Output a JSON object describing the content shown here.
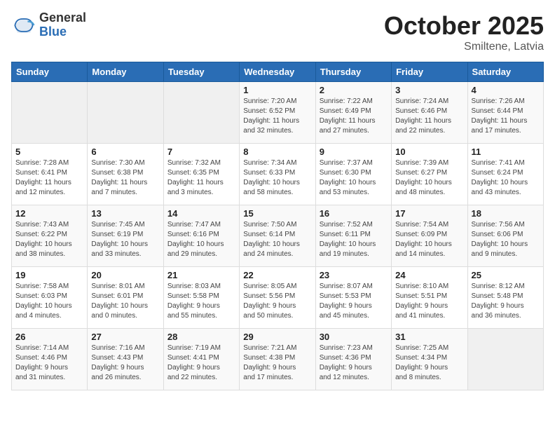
{
  "logo": {
    "general": "General",
    "blue": "Blue"
  },
  "title": "October 2025",
  "subtitle": "Smiltene, Latvia",
  "days_of_week": [
    "Sunday",
    "Monday",
    "Tuesday",
    "Wednesday",
    "Thursday",
    "Friday",
    "Saturday"
  ],
  "weeks": [
    [
      {
        "day": "",
        "info": ""
      },
      {
        "day": "",
        "info": ""
      },
      {
        "day": "",
        "info": ""
      },
      {
        "day": "1",
        "info": "Sunrise: 7:20 AM\nSunset: 6:52 PM\nDaylight: 11 hours\nand 32 minutes."
      },
      {
        "day": "2",
        "info": "Sunrise: 7:22 AM\nSunset: 6:49 PM\nDaylight: 11 hours\nand 27 minutes."
      },
      {
        "day": "3",
        "info": "Sunrise: 7:24 AM\nSunset: 6:46 PM\nDaylight: 11 hours\nand 22 minutes."
      },
      {
        "day": "4",
        "info": "Sunrise: 7:26 AM\nSunset: 6:44 PM\nDaylight: 11 hours\nand 17 minutes."
      }
    ],
    [
      {
        "day": "5",
        "info": "Sunrise: 7:28 AM\nSunset: 6:41 PM\nDaylight: 11 hours\nand 12 minutes."
      },
      {
        "day": "6",
        "info": "Sunrise: 7:30 AM\nSunset: 6:38 PM\nDaylight: 11 hours\nand 7 minutes."
      },
      {
        "day": "7",
        "info": "Sunrise: 7:32 AM\nSunset: 6:35 PM\nDaylight: 11 hours\nand 3 minutes."
      },
      {
        "day": "8",
        "info": "Sunrise: 7:34 AM\nSunset: 6:33 PM\nDaylight: 10 hours\nand 58 minutes."
      },
      {
        "day": "9",
        "info": "Sunrise: 7:37 AM\nSunset: 6:30 PM\nDaylight: 10 hours\nand 53 minutes."
      },
      {
        "day": "10",
        "info": "Sunrise: 7:39 AM\nSunset: 6:27 PM\nDaylight: 10 hours\nand 48 minutes."
      },
      {
        "day": "11",
        "info": "Sunrise: 7:41 AM\nSunset: 6:24 PM\nDaylight: 10 hours\nand 43 minutes."
      }
    ],
    [
      {
        "day": "12",
        "info": "Sunrise: 7:43 AM\nSunset: 6:22 PM\nDaylight: 10 hours\nand 38 minutes."
      },
      {
        "day": "13",
        "info": "Sunrise: 7:45 AM\nSunset: 6:19 PM\nDaylight: 10 hours\nand 33 minutes."
      },
      {
        "day": "14",
        "info": "Sunrise: 7:47 AM\nSunset: 6:16 PM\nDaylight: 10 hours\nand 29 minutes."
      },
      {
        "day": "15",
        "info": "Sunrise: 7:50 AM\nSunset: 6:14 PM\nDaylight: 10 hours\nand 24 minutes."
      },
      {
        "day": "16",
        "info": "Sunrise: 7:52 AM\nSunset: 6:11 PM\nDaylight: 10 hours\nand 19 minutes."
      },
      {
        "day": "17",
        "info": "Sunrise: 7:54 AM\nSunset: 6:09 PM\nDaylight: 10 hours\nand 14 minutes."
      },
      {
        "day": "18",
        "info": "Sunrise: 7:56 AM\nSunset: 6:06 PM\nDaylight: 10 hours\nand 9 minutes."
      }
    ],
    [
      {
        "day": "19",
        "info": "Sunrise: 7:58 AM\nSunset: 6:03 PM\nDaylight: 10 hours\nand 4 minutes."
      },
      {
        "day": "20",
        "info": "Sunrise: 8:01 AM\nSunset: 6:01 PM\nDaylight: 10 hours\nand 0 minutes."
      },
      {
        "day": "21",
        "info": "Sunrise: 8:03 AM\nSunset: 5:58 PM\nDaylight: 9 hours\nand 55 minutes."
      },
      {
        "day": "22",
        "info": "Sunrise: 8:05 AM\nSunset: 5:56 PM\nDaylight: 9 hours\nand 50 minutes."
      },
      {
        "day": "23",
        "info": "Sunrise: 8:07 AM\nSunset: 5:53 PM\nDaylight: 9 hours\nand 45 minutes."
      },
      {
        "day": "24",
        "info": "Sunrise: 8:10 AM\nSunset: 5:51 PM\nDaylight: 9 hours\nand 41 minutes."
      },
      {
        "day": "25",
        "info": "Sunrise: 8:12 AM\nSunset: 5:48 PM\nDaylight: 9 hours\nand 36 minutes."
      }
    ],
    [
      {
        "day": "26",
        "info": "Sunrise: 7:14 AM\nSunset: 4:46 PM\nDaylight: 9 hours\nand 31 minutes."
      },
      {
        "day": "27",
        "info": "Sunrise: 7:16 AM\nSunset: 4:43 PM\nDaylight: 9 hours\nand 26 minutes."
      },
      {
        "day": "28",
        "info": "Sunrise: 7:19 AM\nSunset: 4:41 PM\nDaylight: 9 hours\nand 22 minutes."
      },
      {
        "day": "29",
        "info": "Sunrise: 7:21 AM\nSunset: 4:38 PM\nDaylight: 9 hours\nand 17 minutes."
      },
      {
        "day": "30",
        "info": "Sunrise: 7:23 AM\nSunset: 4:36 PM\nDaylight: 9 hours\nand 12 minutes."
      },
      {
        "day": "31",
        "info": "Sunrise: 7:25 AM\nSunset: 4:34 PM\nDaylight: 9 hours\nand 8 minutes."
      },
      {
        "day": "",
        "info": ""
      }
    ]
  ]
}
